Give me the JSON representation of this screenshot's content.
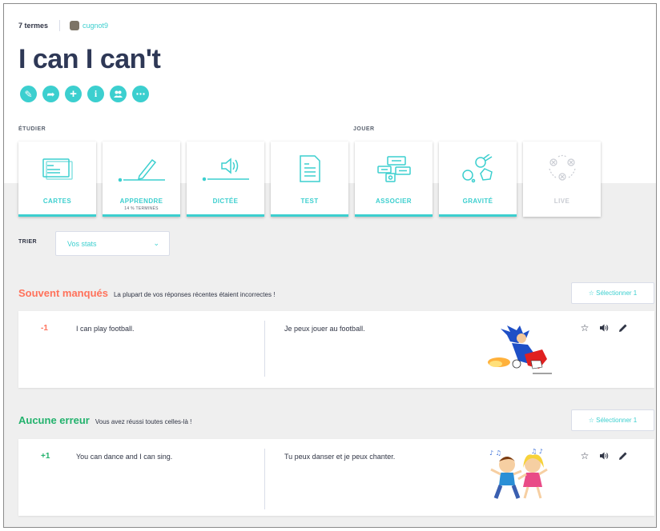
{
  "header": {
    "term_count": "7 termes",
    "username": "cugnot9",
    "title": "I can I can't"
  },
  "actions": [
    {
      "icon": "pencil-icon",
      "glyph": "✎"
    },
    {
      "icon": "share-icon",
      "glyph": "➦"
    },
    {
      "icon": "plus-icon",
      "glyph": "+"
    },
    {
      "icon": "info-icon",
      "glyph": "i"
    },
    {
      "icon": "group-icon",
      "glyph": "👥"
    },
    {
      "icon": "more-icon",
      "glyph": "•••"
    }
  ],
  "sections": {
    "study": "ÉTUDIER",
    "play": "JOUER"
  },
  "modes": [
    {
      "label": "CARTES",
      "sub": "",
      "icon": "flashcards-icon"
    },
    {
      "label": "APPRENDRE",
      "sub": "14 % TERMINÉS",
      "icon": "learn-icon"
    },
    {
      "label": "DICTÉE",
      "sub": "",
      "icon": "dictation-icon"
    },
    {
      "label": "TEST",
      "sub": "",
      "icon": "test-icon"
    },
    {
      "label": "ASSOCIER",
      "sub": "",
      "icon": "match-icon"
    },
    {
      "label": "GRAVITÉ",
      "sub": "",
      "icon": "gravity-icon"
    },
    {
      "label": "LIVE",
      "sub": "",
      "icon": "live-icon"
    }
  ],
  "sort": {
    "label": "TRIER",
    "value": "Vos stats"
  },
  "groups": [
    {
      "title": "Souvent manqués",
      "title_color": "#ff725b",
      "description": "La plupart de vos réponses récentes étaient incorrectes !",
      "select_label": "☆ Sélectionner 1",
      "terms": [
        {
          "score": "-1",
          "score_color": "#ff725b",
          "word": "I can play football.",
          "definition": "Je peux jouer au football."
        }
      ]
    },
    {
      "title": "Aucune erreur",
      "title_color": "#23b26d",
      "description": "Vous avez réussi toutes celles-là !",
      "select_label": "☆ Sélectionner 1",
      "terms": [
        {
          "score": "+1",
          "score_color": "#23b26d",
          "word": "You can dance and I can sing.",
          "definition": "Tu peux danser et je peux chanter."
        }
      ]
    }
  ],
  "colors": {
    "accent": "#3ccfcf",
    "title": "#2e3856",
    "missed": "#ff725b",
    "correct": "#23b26d"
  }
}
